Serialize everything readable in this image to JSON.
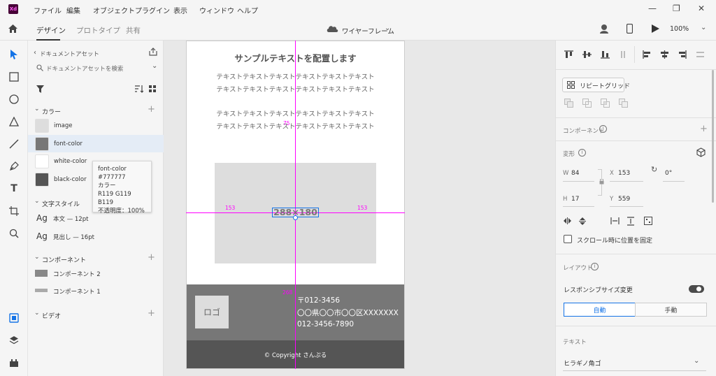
{
  "app": {
    "logo_text": "Xd",
    "menu": [
      "ファイル",
      "編集",
      "オブジェクト",
      "プラグイン",
      "表示",
      "ウィンドウ",
      "ヘルプ"
    ]
  },
  "toolbar": {
    "tabs": [
      "デザイン",
      "プロトタイプ",
      "共有"
    ],
    "doc_title": "ワイヤーフレーム",
    "zoom": "100%"
  },
  "assets": {
    "back_label": "ドキュメントアセット",
    "search_placeholder": "ドキュメントアセットを検索",
    "colors_title": "カラー",
    "colors": [
      {
        "name": "image",
        "hex": "#dddddd"
      },
      {
        "name": "font-color",
        "hex": "#777777"
      },
      {
        "name": "white-color",
        "hex": "#ffffff"
      },
      {
        "name": "black-color",
        "hex": "#555555"
      }
    ],
    "tooltip": {
      "name": "font-color",
      "hex": "#777777",
      "type": "カラー",
      "rgb": "R119 G119 B119",
      "opacity": "不透明度：100%"
    },
    "char_styles_title": "文字スタイル",
    "char_styles": [
      {
        "sample": "Ag",
        "label": "本文 — 12pt"
      },
      {
        "sample": "Ag",
        "label": "見出し — 16pt"
      }
    ],
    "components_title": "コンポーネント",
    "components": [
      "コンポーネント 2",
      "コンポーネント 1"
    ],
    "video_title": "ビデオ"
  },
  "artboard": {
    "heading": "サンプルテキストを配置します",
    "body_lines": [
      "テキストテキストテキストテキストテキストテキスト",
      "テキストテキストテキストテキストテキストテキスト",
      "テキストテキストテキストテキストテキストテキスト",
      "テキストテキストテキストテキストテキストテキスト"
    ],
    "image_size_label": "288×180",
    "guide_left": "153",
    "guide_right": "153",
    "guide_top": "75",
    "guide_bottom": "268",
    "footer": {
      "logo": "ロゴ",
      "postal": "〒012-3456",
      "address": "〇〇県〇〇市〇〇区XXXXXXX",
      "phone": "012-3456-7890",
      "copyright": "© Copyright さんぷる"
    }
  },
  "props": {
    "repeat_grid": "リピートグリッド",
    "component_label": "コンポーネント",
    "transform_label": "変形",
    "w_label": "W",
    "w": "84",
    "h_label": "H",
    "h": "17",
    "x_label": "X",
    "x": "153",
    "y_label": "Y",
    "y": "559",
    "rotation": "0°",
    "fix_scroll": "スクロール時に位置を固定",
    "layout_label": "レイアウト",
    "responsive_label": "レスポンシブサイズ変更",
    "auto": "自動",
    "manual": "手動",
    "text_label": "テキスト",
    "font": "ヒラギノ角ゴ"
  },
  "colors": {
    "accent": "#1473e6",
    "guide": "#ff00ff",
    "footer_top": "#777777",
    "footer_bottom": "#555555"
  }
}
